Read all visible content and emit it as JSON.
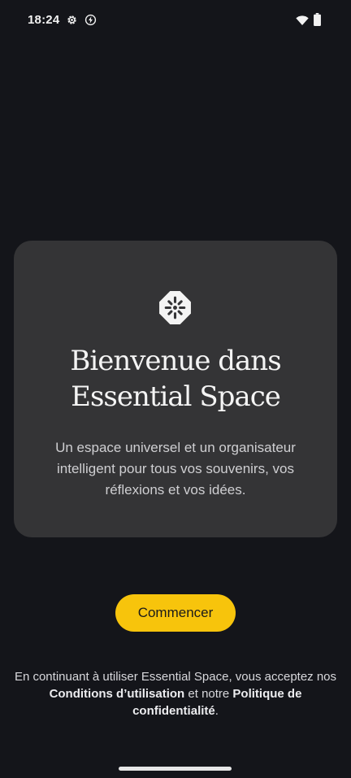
{
  "status_bar": {
    "time": "18:24",
    "icons": [
      "settings-icon",
      "bolt-icon",
      "wifi-icon",
      "battery-icon"
    ]
  },
  "card": {
    "logo_icon": "essential-space-logo-icon",
    "title_line1": "Bienvenue dans",
    "title_line2": "Essential Space",
    "description": "Un espace universel et un organisateur intelligent pour tous vos souvenirs, vos réflexions et vos idées."
  },
  "start_button": {
    "label": "Commencer",
    "color": "#f7c40c"
  },
  "legal": {
    "prefix": "En continuant à utiliser Essential Space, vous acceptez nos",
    "terms_link": "Conditions d’utilisation",
    "middle": " et notre ",
    "privacy_link_part1": "Politique de",
    "privacy_link_part2": "confidentialité",
    "suffix": "."
  },
  "colors": {
    "background": "#14151a",
    "card": "#343436",
    "accent": "#f7c40c"
  }
}
